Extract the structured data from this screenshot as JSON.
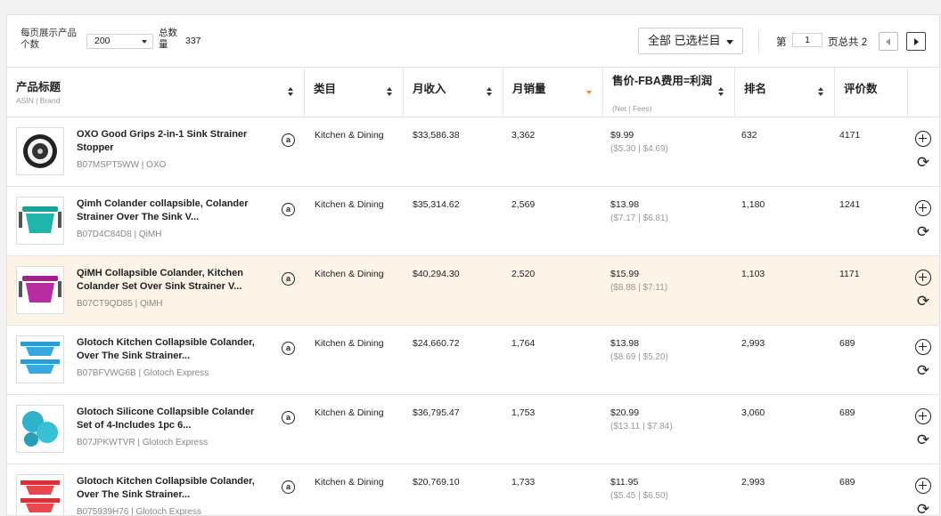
{
  "toolbar": {
    "per_page_label": "每页展示产品个数",
    "per_page_value": "200",
    "total_label": "总数量",
    "total_value": "337",
    "column_select": "全部 已选栏目",
    "page_prefix": "第",
    "page_value": "1",
    "page_suffix": "页总共 2"
  },
  "columns": [
    {
      "label": "产品标题",
      "sub": "ASIN | Brand"
    },
    {
      "label": "类目",
      "sub": ""
    },
    {
      "label": "月收入",
      "sub": ""
    },
    {
      "label": "月销量",
      "sub": ""
    },
    {
      "label": "售价-FBA费用=利润",
      "sub": "(Net | Fees)"
    },
    {
      "label": "排名",
      "sub": ""
    },
    {
      "label": "评价数",
      "sub": ""
    }
  ],
  "rows": [
    {
      "title": "OXO Good Grips 2-in-1 Sink Strainer Stopper",
      "asin_brand": "B07MSPT5WW | OXO",
      "category": "Kitchen & Dining",
      "revenue": "$33,586.38",
      "sales": "3,362",
      "price": "$9.99",
      "net_fees": "($5.30 | $4.69)",
      "rank": "632",
      "reviews": "4171",
      "thumb": "strainer"
    },
    {
      "title": "Qimh Colander collapsible, Colander Strainer Over The Sink V...",
      "asin_brand": "B07D4C84D8 | QiMH",
      "category": "Kitchen & Dining",
      "revenue": "$35,314.62",
      "sales": "2,569",
      "price": "$13.98",
      "net_fees": "($7.17 | $6.81)",
      "rank": "1,180",
      "reviews": "1241",
      "thumb": "colander-teal"
    },
    {
      "title": "QiMH Collapsible Colander, Kitchen Colander Set Over Sink Strainer V...",
      "asin_brand": "B07CT9QD85 | QiMH",
      "category": "Kitchen & Dining",
      "revenue": "$40,294.30",
      "sales": "2,520",
      "price": "$15.99",
      "net_fees": "($8.88 | $7.11)",
      "rank": "1,103",
      "reviews": "1171",
      "thumb": "colander-purple"
    },
    {
      "title": "Glotoch Kitchen Collapsible Colander, Over The Sink Strainer...",
      "asin_brand": "B07BFVWG6B | Glotoch Express",
      "category": "Kitchen & Dining",
      "revenue": "$24,660.72",
      "sales": "1,764",
      "price": "$13.98",
      "net_fees": "($8.69 | $5.20)",
      "rank": "2,993",
      "reviews": "689",
      "thumb": "colander-blue"
    },
    {
      "title": "Glotoch Silicone Collapsible Colander Set of 4-Includes 1pc 6...",
      "asin_brand": "B07JPKWTVR | Glotoch Express",
      "category": "Kitchen & Dining",
      "revenue": "$36,795.47",
      "sales": "1,753",
      "price": "$20.99",
      "net_fees": "($13.11 | $7.84)",
      "rank": "3,060",
      "reviews": "689",
      "thumb": "colander-set"
    },
    {
      "title": "Glotoch Kitchen Collapsible Colander, Over The Sink Strainer...",
      "asin_brand": "B075939H76 | Glotoch Express",
      "category": "Kitchen & Dining",
      "revenue": "$20,769.10",
      "sales": "1,733",
      "price": "$11.95",
      "net_fees": "($5.45 | $6.50)",
      "rank": "2,993",
      "reviews": "689",
      "thumb": "colander-red"
    }
  ],
  "colors": {
    "highlight_row": "#fdf3e6",
    "sort_active": "#f08a24",
    "border": "#e2e2e2"
  }
}
